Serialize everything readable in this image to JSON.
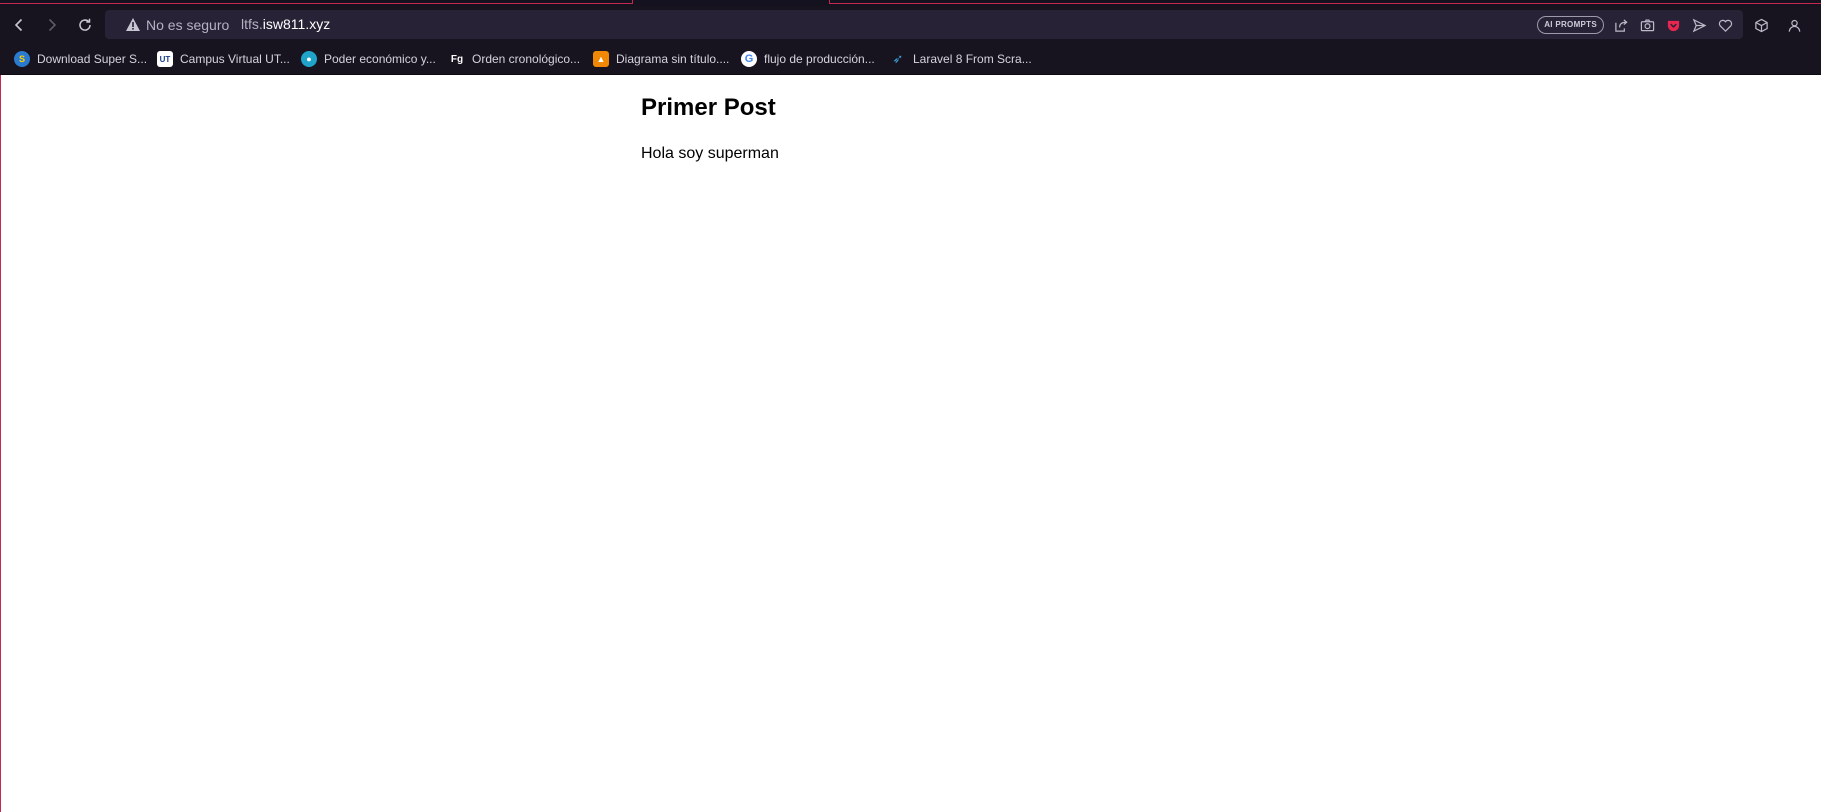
{
  "browser": {
    "security_label": "No es seguro",
    "url_prefix": "ltfs.",
    "url_domain": "isw811.xyz",
    "ai_prompts_label": "AI PROMPTS",
    "accent_color": "#c4274f",
    "chrome_color": "#17141f"
  },
  "bookmarks": [
    {
      "label": "Download Super S...",
      "icon": "superman-favicon"
    },
    {
      "label": "Campus Virtual UT...",
      "icon": "utn-favicon"
    },
    {
      "label": "Poder económico y...",
      "icon": "planet-favicon"
    },
    {
      "label": "Orden cronológico...",
      "icon": "fg-favicon"
    },
    {
      "label": "Diagrama sin título....",
      "icon": "drawio-favicon"
    },
    {
      "label": "flujo de producción...",
      "icon": "google-favicon"
    },
    {
      "label": "Laravel 8 From Scra...",
      "icon": "laracasts-favicon"
    }
  ],
  "post": {
    "title": "Primer Post",
    "body": "Hola soy superman"
  }
}
